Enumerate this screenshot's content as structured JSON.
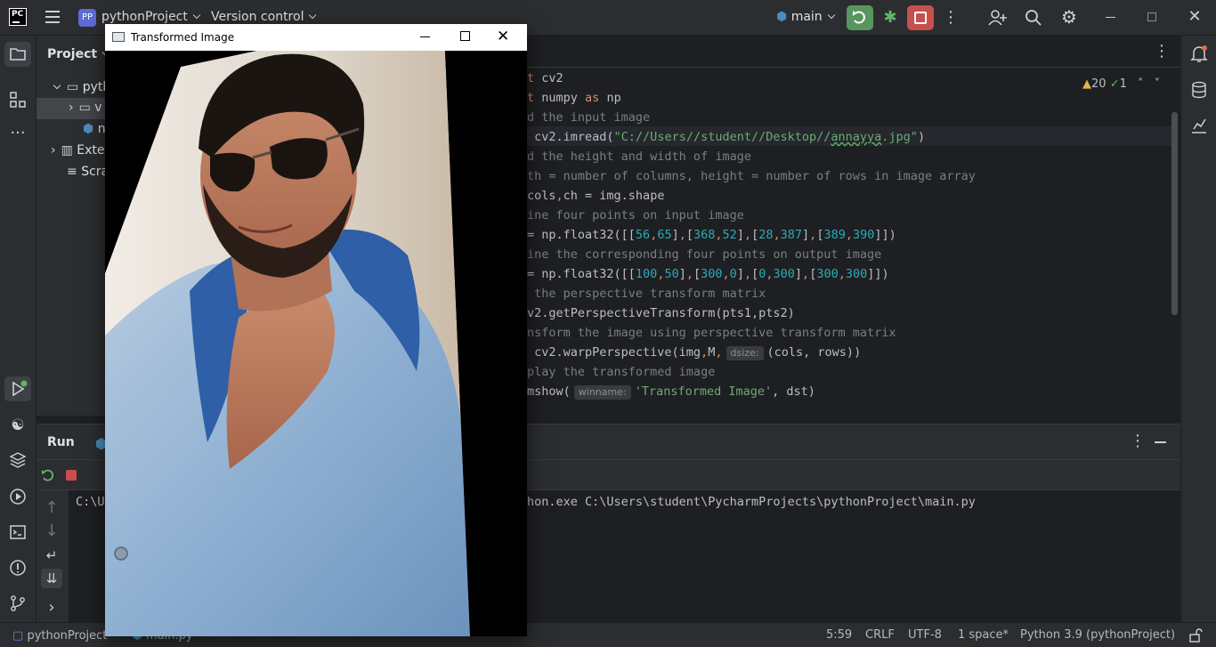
{
  "window": {
    "title": "Transformed Image"
  },
  "toolbar": {
    "project_badge": "PP",
    "project_name": "pythonProject",
    "version_control": "Version control",
    "branch": "main"
  },
  "project_panel": {
    "title": "Project",
    "items": [
      "pyth",
      "v",
      "n",
      "Exte",
      "Scra"
    ]
  },
  "editor": {
    "problems": "20",
    "checks": "1",
    "lines": [
      "t cv2",
      "t numpy as np",
      "d the input image",
      " cv2.imread(\"C://Users//student//Desktop//annayya.jpg\")",
      "d the height and width of image",
      "th = number of columns, height = number of rows in image array",
      "cols,ch = img.shape",
      "ine four points on input image",
      "= np.float32([[56,65],[368,52],[28,387],[389,390]])",
      "ine the corresponding four points on output image",
      "= np.float32([[100,50],[300,0],[0,300],[300,300]])",
      " the perspective transform matrix",
      "v2.getPerspectiveTransform(pts1,pts2)",
      "nsform the image using perspective transform matrix",
      " cv2.warpPerspective(img,M, dsize: (cols, rows))",
      "play the transformed image",
      "mshow( winname: 'Transformed Image', dst)"
    ],
    "hints": {
      "dsize": "dsize:",
      "winname": "winname:"
    }
  },
  "run_panel": {
    "title": "Run",
    "console_left": "C:\\U",
    "console_right": "hon.exe C:\\Users\\student\\PycharmProjects\\pythonProject\\main.py"
  },
  "statusbar": {
    "project": "pythonProject",
    "file": "main.py",
    "position": "5:59",
    "line_sep": "CRLF",
    "encoding": "UTF-8",
    "indent": "1 space*",
    "interpreter": "Python 3.9 (pythonProject)"
  },
  "colors": {
    "run": "#57965c",
    "stop": "#c94f4f",
    "accent": "#3574f0"
  }
}
